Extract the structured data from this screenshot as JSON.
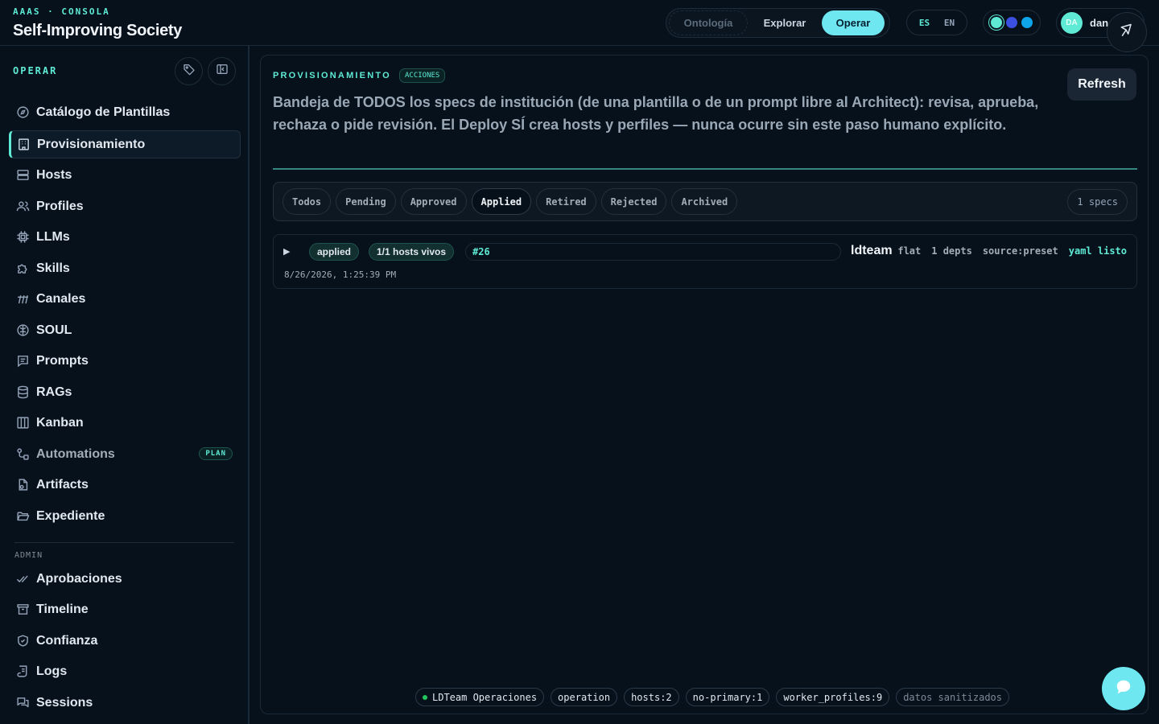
{
  "topbar": {
    "eyebrow": "AAAS · CONSOLA",
    "title": "Self-Improving Society",
    "modes": [
      {
        "label": "Ontología",
        "state": "disabled"
      },
      {
        "label": "Explorar",
        "state": "plain"
      },
      {
        "label": "Operar",
        "state": "active"
      }
    ],
    "lang": {
      "es": "ES",
      "en": "EN"
    },
    "user": {
      "initials": "DA",
      "name": "dan"
    }
  },
  "sidebar": {
    "section_label": "OPERAR",
    "items": [
      {
        "label": "Catálogo de Plantillas",
        "icon": "compass-icon"
      },
      {
        "label": "Provisionamiento",
        "icon": "building-icon",
        "active": true
      },
      {
        "label": "Hosts",
        "icon": "server-icon"
      },
      {
        "label": "Profiles",
        "icon": "users-icon"
      },
      {
        "label": "LLMs",
        "icon": "cpu-icon"
      },
      {
        "label": "Skills",
        "icon": "puzzle-icon"
      },
      {
        "label": "Canales",
        "icon": "antenna-icon"
      },
      {
        "label": "SOUL",
        "icon": "brain-icon"
      },
      {
        "label": "Prompts",
        "icon": "message-lines-icon"
      },
      {
        "label": "RAGs",
        "icon": "database-icon"
      },
      {
        "label": "Kanban",
        "icon": "columns-icon"
      },
      {
        "label": "Automations",
        "icon": "workflow-icon",
        "badge": "PLAN"
      },
      {
        "label": "Artifacts",
        "icon": "file-code-icon"
      },
      {
        "label": "Expediente",
        "icon": "folder-open-icon"
      }
    ],
    "admin_label": "ADMIN",
    "admin_items": [
      {
        "label": "Aprobaciones",
        "icon": "double-check-icon"
      },
      {
        "label": "Timeline",
        "icon": "archive-icon"
      },
      {
        "label": "Confianza",
        "icon": "shield-check-icon"
      },
      {
        "label": "Logs",
        "icon": "scroll-icon"
      },
      {
        "label": "Sessions",
        "icon": "chat-bubbles-icon"
      }
    ]
  },
  "main": {
    "eyebrow": "PROVISIONAMIENTO",
    "badge": "ACCIONES",
    "description": "Bandeja de TODOS los specs de institución (de una plantilla o de un prompt libre al Architect): revisa, aprueba, rechaza o pide revisión. El Deploy SÍ crea hosts y perfiles — nunca ocurre sin este paso humano explícito.",
    "refresh_label": "Refresh",
    "filters": [
      "Todos",
      "Pending",
      "Approved",
      "Applied",
      "Retired",
      "Rejected",
      "Archived"
    ],
    "active_filter": "Applied",
    "spec_count": "1 specs",
    "specs": [
      {
        "status": "applied",
        "hosts": "1/1 hosts vivos",
        "id": "#26",
        "name": "ldteam",
        "topology": "flat",
        "depts": "1 depts",
        "source": "source:preset",
        "yaml": "yaml listo",
        "date": "8/26/2026, 1:25:39 PM"
      }
    ],
    "footer_chips": [
      "LDTeam Operaciones",
      "operation",
      "hosts:2",
      "no-primary:1",
      "worker_profiles:9",
      "datos sanitizados"
    ]
  },
  "colors": {
    "accent": "#5eead4",
    "active_mode": "#6ee7f0",
    "background": "#07111c",
    "live_dot": "#22c55e"
  }
}
